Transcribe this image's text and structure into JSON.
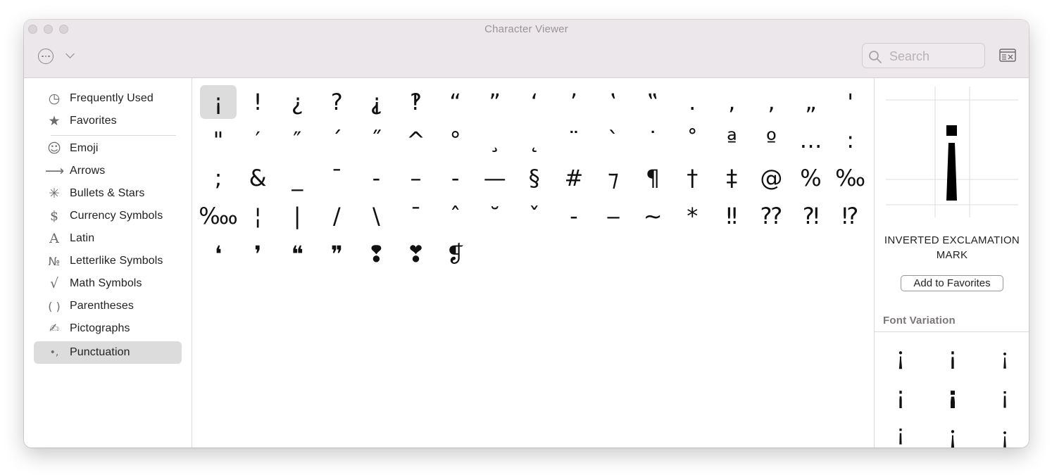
{
  "window": {
    "title": "Character Viewer"
  },
  "toolbar": {
    "search_placeholder": "Search"
  },
  "sidebar": {
    "items": [
      {
        "icon": "clock-icon",
        "glyph": "◷",
        "label": "Frequently Used"
      },
      {
        "icon": "star-icon",
        "glyph": "★",
        "label": "Favorites"
      },
      {
        "icon": "emoji-icon",
        "glyph": "☺",
        "label": "Emoji"
      },
      {
        "icon": "arrow-icon",
        "glyph": "⟶",
        "label": "Arrows"
      },
      {
        "icon": "asterisk-icon",
        "glyph": "✳",
        "label": "Bullets & Stars"
      },
      {
        "icon": "dollar-icon",
        "glyph": "$",
        "label": "Currency Symbols"
      },
      {
        "icon": "latin-a-icon",
        "glyph": "A",
        "label": "Latin"
      },
      {
        "icon": "numero-icon",
        "glyph": "№",
        "label": "Letterlike Symbols"
      },
      {
        "icon": "square-root-icon",
        "glyph": "√",
        "label": "Math Symbols"
      },
      {
        "icon": "parentheses-icon",
        "glyph": "( )",
        "label": "Parentheses"
      },
      {
        "icon": "pictograph-icon",
        "glyph": "✍",
        "label": "Pictographs"
      },
      {
        "icon": "punctuation-icon",
        "glyph": "•,",
        "label": "Punctuation"
      }
    ],
    "selected": "Punctuation"
  },
  "characters": {
    "rows": [
      [
        "¡",
        "!",
        "¿",
        "?",
        "⸘",
        "‽",
        "“",
        "”",
        "‘",
        "’",
        "‛",
        "‟",
        ".",
        ",",
        "‚",
        "„",
        "'"
      ],
      [
        "\"",
        "′",
        "″",
        "´",
        "˝",
        "^",
        "°",
        "¸",
        "˛",
        "¨",
        "`",
        "˙",
        "˚",
        "ª",
        "º",
        "…",
        ":"
      ],
      [
        ";",
        "&",
        "_",
        "¯",
        "‐",
        "–",
        "‑",
        "—",
        "§",
        "#",
        "⁊",
        "¶",
        "†",
        "‡",
        "@",
        "%",
        "‰"
      ],
      [
        "‱",
        "¦",
        "|",
        "/",
        "\\",
        "ˉ",
        "ˆ",
        "˘",
        "ˇ",
        "-",
        "‒",
        "~",
        "*",
        "‼",
        "⁇",
        "⁈",
        "⁉"
      ],
      [
        "❛",
        "❜",
        "❝",
        "❞",
        "❢",
        "❣",
        "❡"
      ]
    ],
    "selected": "¡"
  },
  "detail": {
    "glyph": "¡",
    "name": "INVERTED EXCLAMATION MARK",
    "add_favorites_label": "Add to Favorites",
    "font_variation_label": "Font Variation",
    "variations": [
      "¡",
      "¡",
      "¡",
      "¡",
      "¡",
      "¡",
      "¡",
      "¡",
      "¡"
    ]
  }
}
